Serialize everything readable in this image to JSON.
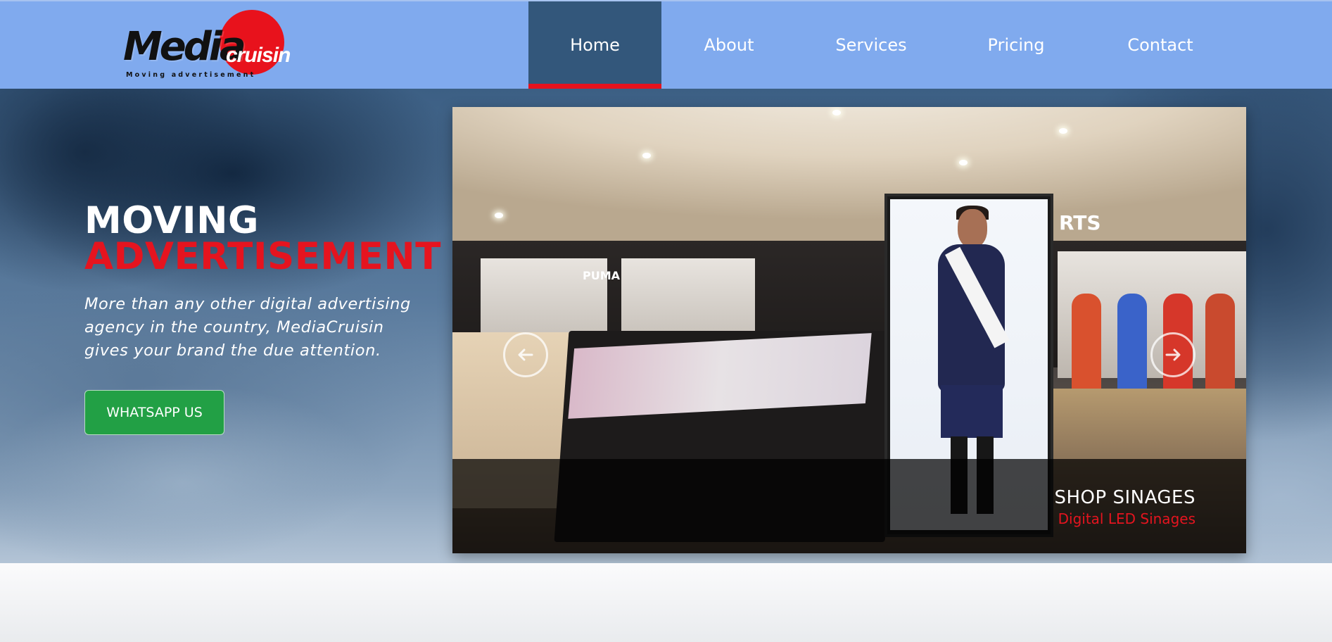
{
  "brand": {
    "name_part1": "Media",
    "name_part2": "cruisin",
    "tagline": "Moving advertisement",
    "accent_color": "#e8121c",
    "nav_bg": "#80aaee"
  },
  "nav": {
    "items": [
      {
        "label": "Home",
        "active": true
      },
      {
        "label": "About",
        "active": false
      },
      {
        "label": "Services",
        "active": false
      },
      {
        "label": "Pricing",
        "active": false
      },
      {
        "label": "Contact",
        "active": false
      }
    ]
  },
  "hero": {
    "title_line1": "MOVING",
    "title_line2": "ADVERTISEMENT",
    "description": "More than any other digital advertising agency in the country, MediaCruisin gives your brand the due attention.",
    "cta_label": "WHATSAPP US",
    "cta_color": "#22a045"
  },
  "slider": {
    "caption_title": "SHOP SINAGES",
    "caption_subtitle": "Digital LED Sinages",
    "prev_icon": "arrow-left-icon",
    "next_icon": "arrow-right-icon",
    "store_sign_left": "PUMA",
    "store_sign_right": "RTS"
  }
}
